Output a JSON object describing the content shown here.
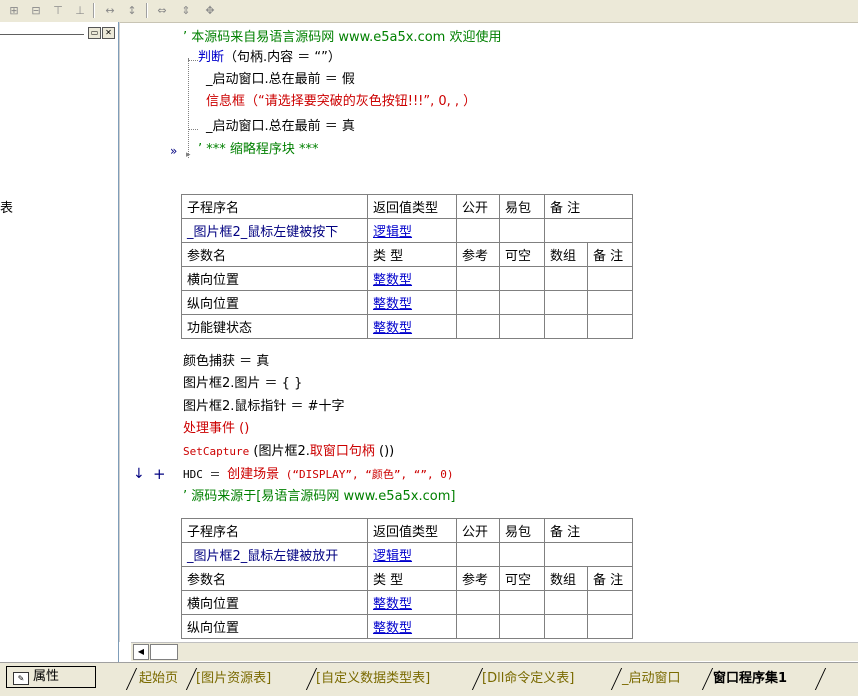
{
  "toolbar": {
    "icons": [
      "align-left-icon",
      "align-center-icon",
      "align-top-icon",
      "align-bottom-icon",
      "same-width-icon",
      "same-height-icon",
      "center-h-icon",
      "center-v-icon",
      "center-both-icon"
    ]
  },
  "code": {
    "line1": "’ 本源码来自易语言源码网 www.e5a5x.com  欢迎使用",
    "line2_kw": "判断",
    "line2_rest": "（句柄.内容 ＝ “”）",
    "line3": "_启动窗口.总在最前 ＝ 假",
    "line4_kw": "信息框",
    "line4_rest": "（“请选择要突破的灰色按钮!!!”, 0, , ）",
    "line5": "_启动窗口.总在最前 ＝ 真",
    "line6": "’ *** 缩略程序块 ***",
    "after1": "颜色捕获 ＝ 真",
    "after2": "图片框2.图片 ＝ { }",
    "after3": "图片框2.鼠标指针 ＝ #十字",
    "after4": "处理事件 ()",
    "after5_fn": "SetCapture",
    "after5_rest": " (图片框2.",
    "after5_call": "取窗口句柄",
    "after5_end": " ())",
    "after6_a": "HDC ＝ ",
    "after6_fn": "创建场景",
    "after6_args": " (“DISPLAY”, “颜色”, “”, 0)",
    "after7": "’ 源码来源于[易语言源码网 www.e5a5x.com]"
  },
  "sub1": {
    "headers": [
      "子程序名",
      "返回值类型",
      "公开",
      "易包",
      "备 注"
    ],
    "name": "_图片框2_鼠标左键被按下",
    "ret": "逻辑型",
    "param_headers": [
      "参数名",
      "类 型",
      "参考",
      "可空",
      "数组",
      "备 注"
    ],
    "params": [
      {
        "name": "横向位置",
        "type": "整数型"
      },
      {
        "name": "纵向位置",
        "type": "整数型"
      },
      {
        "name": "功能键状态",
        "type": "整数型"
      }
    ]
  },
  "sub2": {
    "headers": [
      "子程序名",
      "返回值类型",
      "公开",
      "易包",
      "备 注"
    ],
    "name": "_图片框2_鼠标左键被放开",
    "ret": "逻辑型",
    "param_headers": [
      "参数名",
      "类 型",
      "参考",
      "可空",
      "数组",
      "备 注"
    ],
    "params": [
      {
        "name": "横向位置",
        "type": "整数型"
      },
      {
        "name": "纵向位置",
        "type": "整数型"
      }
    ]
  },
  "gutter": {
    "arrow_marker": "»",
    "down_marker": "↓",
    "plus_marker": "+"
  },
  "left_panel": {
    "fragment": "表"
  },
  "bottom": {
    "properties_label": "属性",
    "tabs": [
      "起始页",
      "[图片资源表]",
      "[自定义数据类型表]",
      "[Dll命令定义表]",
      "_启动窗口",
      "窗口程序集1"
    ],
    "active_tab": "窗口程序集1"
  },
  "colors": {
    "comment": "#008000",
    "keyword": "#0000cc",
    "command": "#cc0000",
    "tab_text": "#7a6a00"
  }
}
